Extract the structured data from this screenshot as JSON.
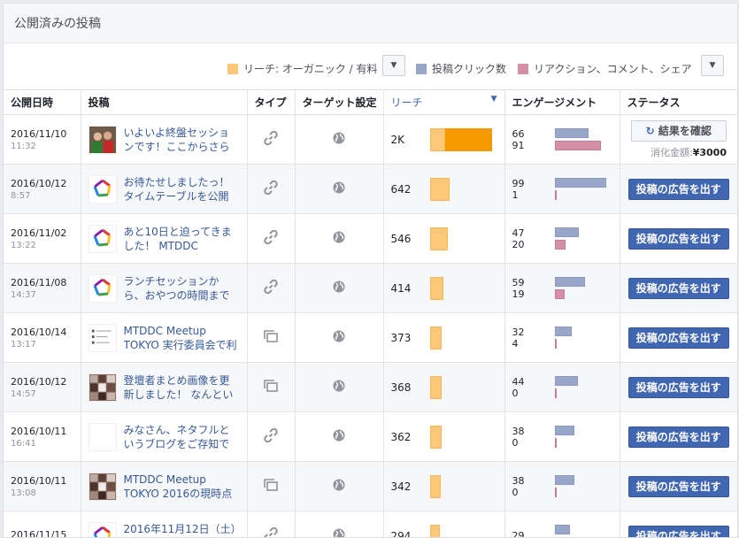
{
  "page": {
    "title": "公開済みの投稿"
  },
  "legend": {
    "reach_label": "リーチ: オーガニック / 有料",
    "clicks_label": "投稿クリック数",
    "reactions_label": "リアクション、コメント、シェア",
    "colors": {
      "organic": "#ffc879",
      "paid": "#f49a00",
      "clicks": "#9aa6c8",
      "reactions": "#d58fa6"
    }
  },
  "table": {
    "headers": {
      "date": "公開日時",
      "post": "投稿",
      "type": "タイプ",
      "target": "ターゲット設定",
      "reach": "リーチ",
      "engagement": "エンゲージメント",
      "status": "ステータス"
    },
    "rows": [
      {
        "date": "2016/11/10",
        "time": "11:32",
        "text": "いよいよ終盤セッションです！ここからさら",
        "thumb": "photo",
        "type": "link-icon",
        "reach": "2K",
        "organic": 0.24,
        "paid": 0.76,
        "clicks": "66",
        "reactions": "91",
        "click_frac": 0.65,
        "react_frac": 0.9,
        "status": "result",
        "result_label": "結果を確認",
        "spent_label": "消化金額:",
        "spent_value": "¥3000"
      },
      {
        "date": "2016/10/12",
        "time": "8:57",
        "text": "お待たせしましたっ！タイムテーブルを公開",
        "thumb": "logo",
        "type": "link-icon",
        "reach": "642",
        "organic": 0.32,
        "paid": 0,
        "clicks": "99",
        "reactions": "1",
        "click_frac": 1.0,
        "react_frac": 0.02,
        "status": "boost",
        "boost_label": "投稿の広告を出す"
      },
      {
        "date": "2016/11/02",
        "time": "13:22",
        "text": "あと10日と迫ってきました！ MTDDC Meetup",
        "thumb": "logo",
        "type": "link-icon",
        "reach": "546",
        "organic": 0.28,
        "paid": 0,
        "clicks": "47",
        "reactions": "20",
        "click_frac": 0.47,
        "react_frac": 0.2,
        "status": "boost",
        "boost_label": "投稿の広告を出す"
      },
      {
        "date": "2016/11/08",
        "time": "14:37",
        "text": "ランチセッションから、おやつの時間まで",
        "thumb": "logo",
        "type": "link-icon",
        "reach": "414",
        "organic": 0.21,
        "paid": 0,
        "clicks": "59",
        "reactions": "19",
        "click_frac": 0.59,
        "react_frac": 0.19,
        "status": "boost",
        "boost_label": "投稿の広告を出す"
      },
      {
        "date": "2016/10/14",
        "time": "13:17",
        "text": "MTDDC Meetup TOKYO 実行委員会で利用し",
        "thumb": "doc",
        "type": "album-icon",
        "reach": "373",
        "organic": 0.18,
        "paid": 0,
        "clicks": "32",
        "reactions": "4",
        "click_frac": 0.32,
        "react_frac": 0.04,
        "status": "boost",
        "boost_label": "投稿の広告を出す"
      },
      {
        "date": "2016/10/12",
        "time": "14:57",
        "text": "登壇者まとめ画像を更新しました！ なんとい",
        "thumb": "collage",
        "type": "album-icon",
        "reach": "368",
        "organic": 0.18,
        "paid": 0,
        "clicks": "44",
        "reactions": "0",
        "click_frac": 0.44,
        "react_frac": 0.01,
        "status": "boost",
        "boost_label": "投稿の広告を出す"
      },
      {
        "date": "2016/10/11",
        "time": "16:41",
        "text": "みなさん、ネタフルというブログをご存知で",
        "thumb": "blank",
        "type": "link-icon",
        "reach": "362",
        "organic": 0.18,
        "paid": 0,
        "clicks": "38",
        "reactions": "0",
        "click_frac": 0.38,
        "react_frac": 0.01,
        "status": "boost",
        "boost_label": "投稿の広告を出す"
      },
      {
        "date": "2016/10/11",
        "time": "13:08",
        "text": "MTDDC Meetup TOKYO 2016の現時点での登",
        "thumb": "collage",
        "type": "album-icon",
        "reach": "342",
        "organic": 0.17,
        "paid": 0,
        "clicks": "38",
        "reactions": "0",
        "click_frac": 0.38,
        "react_frac": 0.01,
        "status": "boost",
        "boost_label": "投稿の広告を出す"
      },
      {
        "date": "2016/11/15",
        "time": "",
        "text": "2016年11月12日（土）",
        "thumb": "logo",
        "type": "link-icon",
        "reach": "294",
        "organic": 0.15,
        "paid": 0,
        "clicks": "29",
        "reactions": "",
        "click_frac": 0.29,
        "react_frac": 0,
        "status": "boost",
        "boost_label": "投稿の広告を出す"
      }
    ]
  }
}
